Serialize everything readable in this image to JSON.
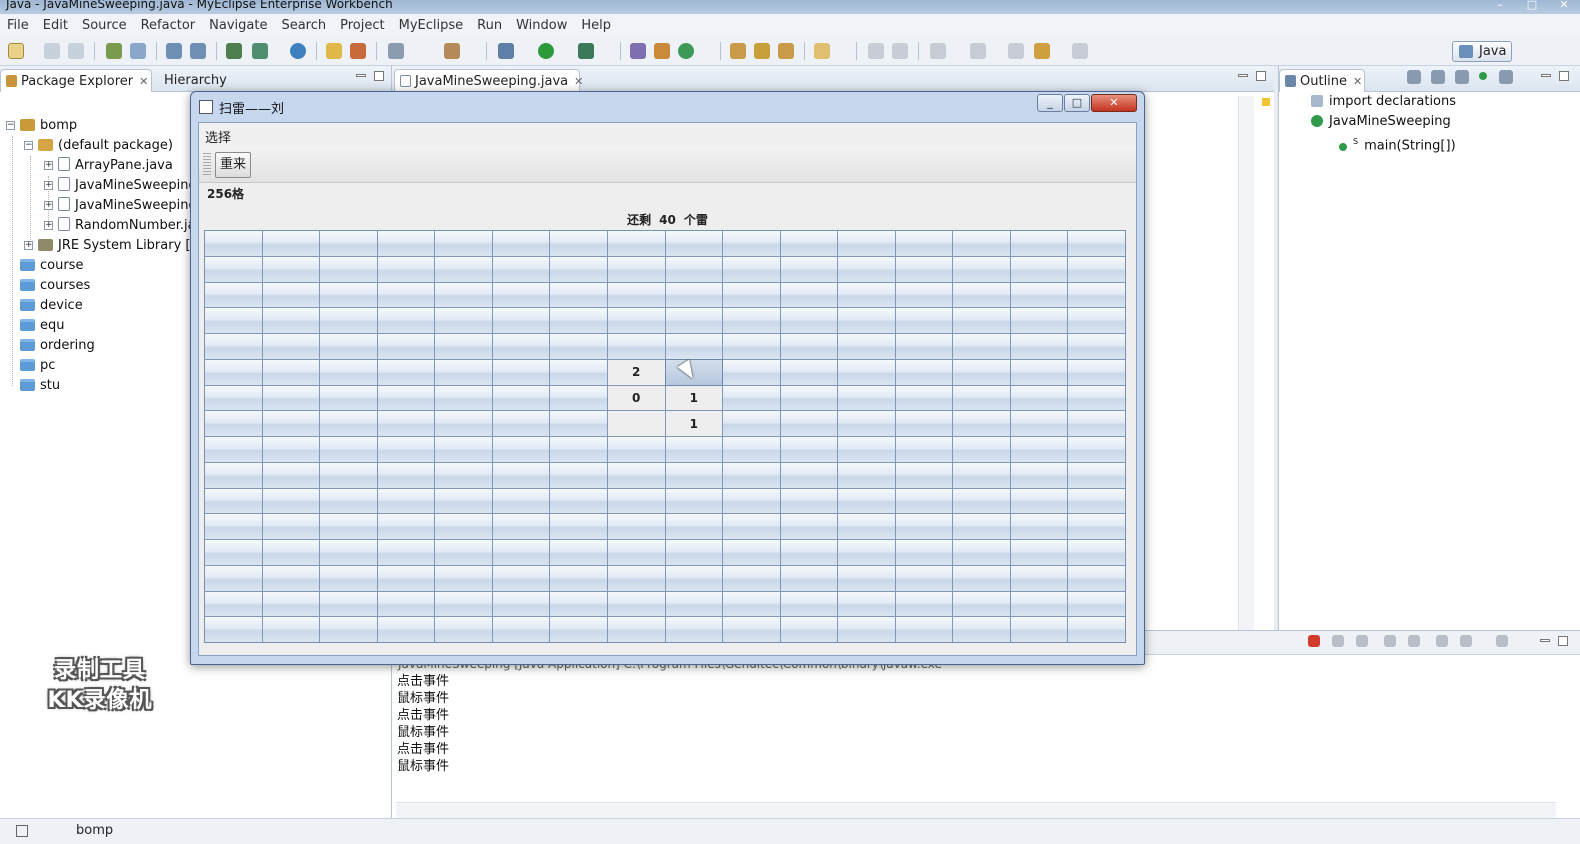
{
  "window": {
    "title": "Java - JavaMineSweeping.java - MyEclipse Enterprise Workbench"
  },
  "menu": [
    "File",
    "Edit",
    "Source",
    "Refactor",
    "Navigate",
    "Search",
    "Project",
    "MyEclipse",
    "Run",
    "Window",
    "Help"
  ],
  "perspective": {
    "label": "Java"
  },
  "left_panel": {
    "tabs": [
      {
        "label": "Package Explorer"
      },
      {
        "label": "Hierarchy"
      }
    ],
    "tree": [
      {
        "label": "bomp",
        "icon": "project-icon"
      },
      {
        "label": "(default package)",
        "icon": "package-icon"
      },
      {
        "label": "ArrayPane.java",
        "icon": "java-file-icon"
      },
      {
        "label": "JavaMineSweeping",
        "icon": "java-file-icon"
      },
      {
        "label": "JavaMineSweeping",
        "icon": "java-file-icon"
      },
      {
        "label": "RandomNumber.ja",
        "icon": "java-file-icon"
      },
      {
        "label": "JRE System Library [jdl",
        "icon": "library-icon"
      },
      {
        "label": "course",
        "icon": "folder-icon"
      },
      {
        "label": "courses",
        "icon": "folder-icon"
      },
      {
        "label": "device",
        "icon": "folder-icon"
      },
      {
        "label": "equ",
        "icon": "folder-icon"
      },
      {
        "label": "ordering",
        "icon": "folder-icon"
      },
      {
        "label": "pc",
        "icon": "folder-icon"
      },
      {
        "label": "stu",
        "icon": "folder-icon"
      }
    ]
  },
  "editor": {
    "tab_label": "JavaMineSweeping.java"
  },
  "outline": {
    "tab_label": "Outline",
    "items": [
      {
        "label": "import declarations"
      },
      {
        "label": "JavaMineSweeping"
      },
      {
        "label": "main(String[])",
        "modifier": "S"
      }
    ]
  },
  "console": {
    "header": "JavaMineSweeping [Java Application] C:\\Program Files\\Genuitec\\Common\\binary\\javaw.exe",
    "lines": [
      "点击事件",
      "鼠标事件",
      "点击事件",
      "鼠标事件",
      "点击事件",
      "鼠标事件"
    ]
  },
  "status_bar": {
    "selection": "bomp"
  },
  "watermark": {
    "line1": "录制工具",
    "line2": "KK录像机"
  },
  "game": {
    "title": "扫雷——刘",
    "menu_label": "选择",
    "restart_label": "重来",
    "cells_label": "256格",
    "remaining_prefix": "还剩",
    "remaining_count": "40",
    "remaining_suffix": "个雷",
    "rows": 16,
    "cols": 16,
    "revealed": [
      {
        "row": 5,
        "col": 7,
        "value": "2"
      },
      {
        "row": 6,
        "col": 7,
        "value": "0"
      },
      {
        "row": 6,
        "col": 8,
        "value": "1"
      },
      {
        "row": 7,
        "col": 7,
        "value": ""
      },
      {
        "row": 7,
        "col": 8,
        "value": "1"
      }
    ],
    "hovered": {
      "row": 5,
      "col": 8
    }
  }
}
